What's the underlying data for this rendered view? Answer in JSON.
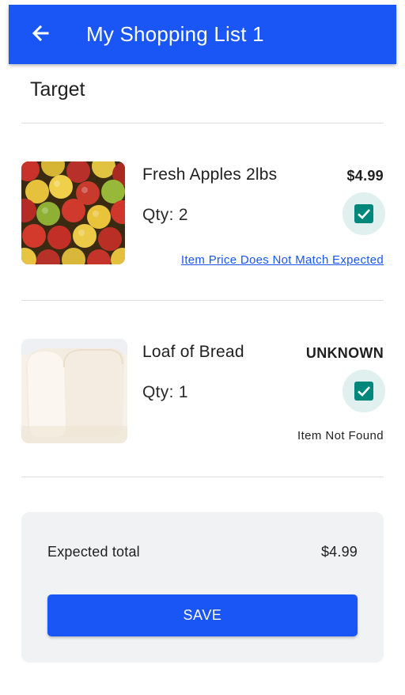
{
  "header": {
    "title": "My Shopping List 1",
    "back_icon": "arrow-left-icon",
    "background_color": "#1a55f6"
  },
  "store": {
    "name": "Target"
  },
  "items": [
    {
      "name": "Fresh Apples 2lbs",
      "price": "$4.99",
      "qty": "Qty: 2",
      "checked": true,
      "status": "Item Price Does Not Match Expected",
      "status_is_link": true,
      "image": "apples-image"
    },
    {
      "name": "Loaf of Bread",
      "price": "UNKNOWN",
      "qty": "Qty: 1",
      "checked": true,
      "status": "Item Not Found",
      "status_is_link": false,
      "image": "bread-image"
    }
  ],
  "summary": {
    "label": "Expected total",
    "value": "$4.99",
    "save_label": "SAVE"
  },
  "colors": {
    "accent": "#1a55f6",
    "checkbox": "#00877b",
    "checkbox_halo": "#dff0ee",
    "summary_bg": "#f1f2f4"
  }
}
